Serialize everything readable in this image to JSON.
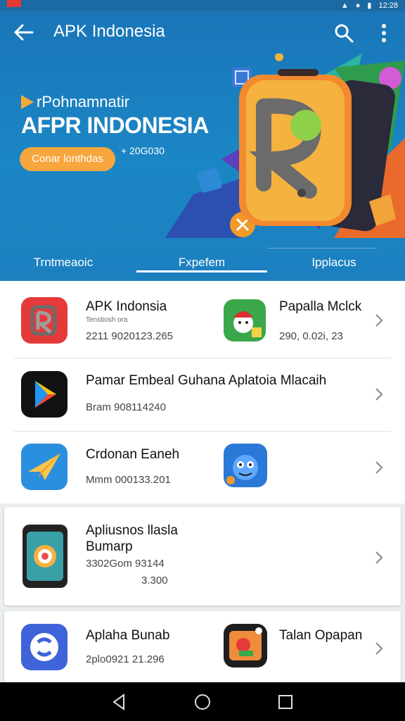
{
  "statusbar": {
    "time": "12:28"
  },
  "appbar": {
    "title": "APK Indonesia"
  },
  "hero": {
    "brand_line": "rPohnamnatir",
    "brand_title": "AFPR INDONESIA",
    "cta_label": "Conar lonthdas",
    "count": "+ 20G030"
  },
  "tabs": [
    {
      "label": "Trntmeaoic"
    },
    {
      "label": "Fxpefem"
    },
    {
      "label": "Ipplacus"
    }
  ],
  "list": [
    {
      "left": {
        "title": "APK Indonsia",
        "tiny": "Tenstiosh ora",
        "sub": "2211 9020123.265",
        "icon": "apk-indonesia-app-icon"
      },
      "right": {
        "title": "Papalla Mclck",
        "sub": "290, 0.02i, 23",
        "icon": "cartoon-character-app-icon"
      }
    },
    {
      "left": {
        "title": "Pamar Embeal Guhana Aplatoia Mlacaih",
        "sub": "Bram 908114240",
        "icon": "play-store-app-icon"
      }
    },
    {
      "left": {
        "title": "Crdonan Eaneh",
        "sub": "Mmm 000133.201",
        "icon": "paper-plane-app-icon"
      },
      "right": {
        "icon": "monster-game-app-icon"
      }
    },
    {
      "left": {
        "title": "Apliusnos llasla",
        "title2": "Bumarp",
        "sub": "3302Gom 93144",
        "sub2": "3.300",
        "icon": "phone-search-app-icon"
      }
    },
    {
      "left": {
        "title": "Aplaha Bunab",
        "sub": "2plo0921 21.296",
        "icon": "shield-app-icon"
      },
      "right": {
        "title": "Talan Opapan",
        "icon": "flower-app-icon"
      }
    }
  ],
  "colors": {
    "primary": "#1b7fc0",
    "accent": "#f7a63e"
  }
}
